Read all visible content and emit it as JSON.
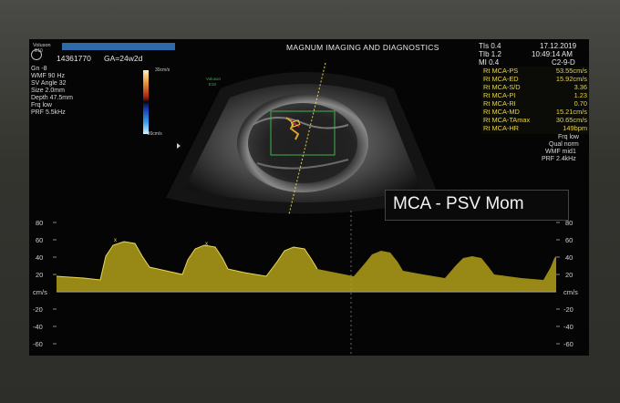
{
  "header": {
    "brand": "Voluson",
    "model": "E10",
    "patient_id": "14361770",
    "ga": "GA=24w2d",
    "clinic": "MAGNUM IMAGING AND DIAGNOSTICS",
    "tis": "TIs 0.4",
    "tib": "TIb 1.2",
    "mi": "MI 0.4",
    "date": "17.12.2019",
    "time": "10:49:14 AM",
    "probe": "C2-9-D"
  },
  "left_params": [
    "Gn  -8",
    "WMF 90 Hz",
    "SV Angle 32",
    "Size  2.0mm",
    "Depth 47.5mm",
    "Frq low",
    "PRF  5.5kHz"
  ],
  "colorbar": {
    "top": "30cm/s",
    "bottom": "-30cm/s"
  },
  "image_tag": {
    "brand": "Voluson",
    "model": "E10"
  },
  "measurements": [
    {
      "label": "Rt MCA-PS",
      "value": "53.55cm/s"
    },
    {
      "label": "Rt MCA-ED",
      "value": "15.92cm/s"
    },
    {
      "label": "Rt MCA-S/D",
      "value": "3.36"
    },
    {
      "label": "Rt MCA-PI",
      "value": "1.23"
    },
    {
      "label": "Rt MCA-RI",
      "value": "0.70"
    },
    {
      "label": "Rt MCA-MD",
      "value": "15.21cm/s"
    },
    {
      "label": "Rt MCA-TAmax",
      "value": "30.65cm/s"
    },
    {
      "label": "Rt MCA-HR",
      "value": "149bpm"
    }
  ],
  "doppler_params": [
    "Frq low",
    "Qual norm",
    "WMF mid1",
    "PRF  2.4kHz"
  ],
  "annotation": "MCA - PSV Mom",
  "axis_left": [
    "80",
    "60",
    "40",
    "20",
    "cm/s",
    "-20",
    "-40",
    "-60"
  ],
  "axis_right": [
    "80",
    "60",
    "40",
    "20",
    "cm/s",
    "-20",
    "-40",
    "-60"
  ],
  "colors": {
    "trace": "#c9b21e",
    "text": "#e6d44a",
    "blue_bar": "#2f6aa8"
  }
}
